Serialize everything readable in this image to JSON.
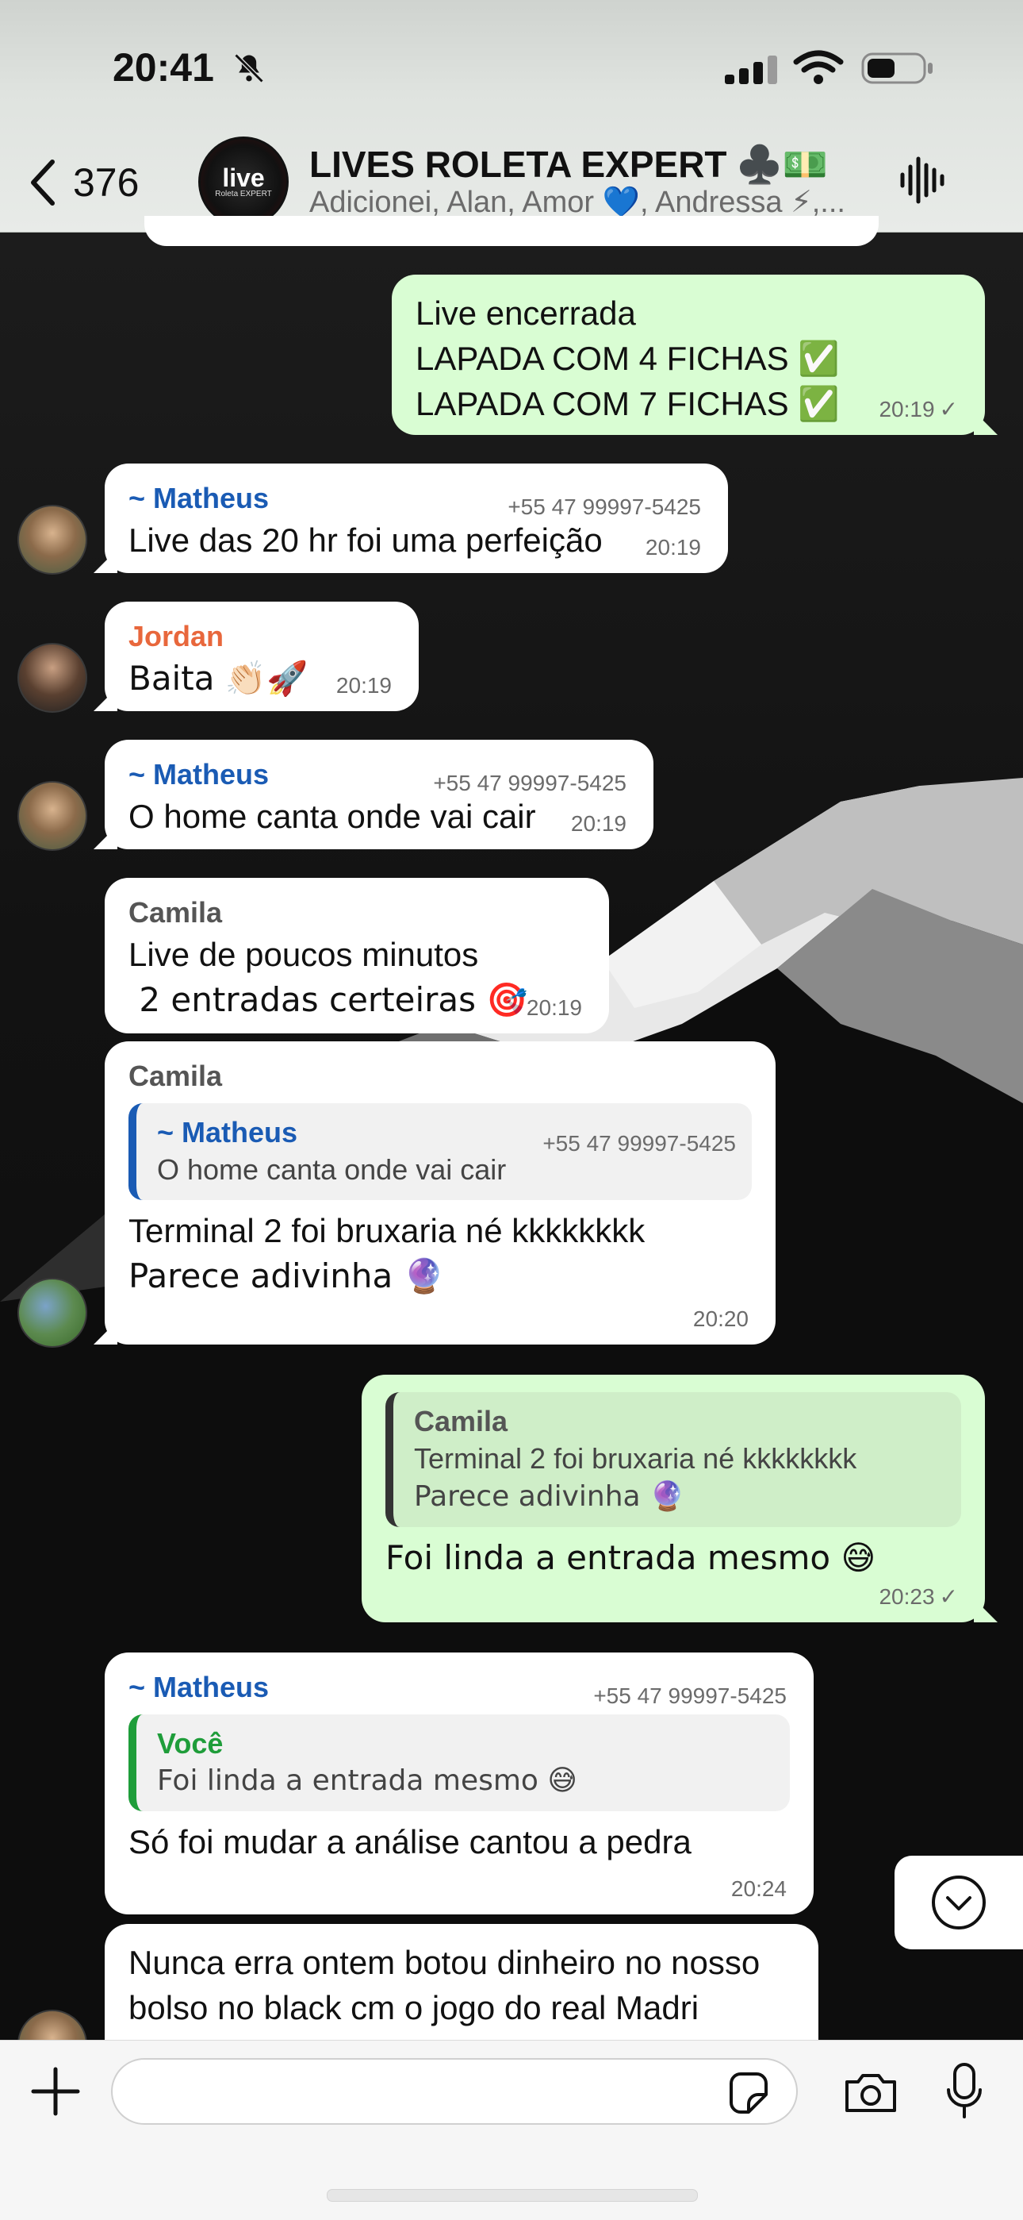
{
  "status_bar": {
    "time": "20:41"
  },
  "header": {
    "back_count": "376",
    "avatar_text_main": "live",
    "avatar_text_sub": "Roleta EXPERT",
    "title": "LIVES ROLETA EXPERT ♣️💵",
    "members": "Adicionei, Alan, Amor 💙, Andressa ⚡,..."
  },
  "messages": [
    {
      "direction": "out",
      "lines": [
        "Live encerrada",
        "LAPADA COM 4 FICHAS ✅",
        "LAPADA COM 7 FICHAS ✅"
      ],
      "time": "20:19"
    },
    {
      "direction": "in",
      "sender": "~ Matheus",
      "phone": "+55 47 99997-5425",
      "text": "Live das 20 hr foi uma perfeição",
      "time": "20:19"
    },
    {
      "direction": "in",
      "sender": "Jordan",
      "text": "Baita 👏🏻🚀",
      "time": "20:19"
    },
    {
      "direction": "in",
      "sender": "~ Matheus",
      "phone": "+55 47 99997-5425",
      "text": "O home canta onde vai cair",
      "time": "20:19"
    },
    {
      "direction": "in",
      "sender": "Camila",
      "lines": [
        "Live de poucos minutos",
        " 2 entradas certeiras 🎯"
      ],
      "time": "20:19"
    },
    {
      "direction": "in",
      "sender": "Camila",
      "quote": {
        "name": "~ Matheus",
        "phone": "+55 47 99997-5425",
        "text": "O home canta onde vai cair"
      },
      "lines": [
        "Terminal 2 foi bruxaria né kkkkkkkk",
        "Parece adivinha 🔮"
      ],
      "time": "20:20"
    },
    {
      "direction": "out",
      "quote": {
        "name": "Camila",
        "lines": [
          "Terminal 2 foi bruxaria né kkkkkkkk",
          "Parece adivinha 🔮"
        ]
      },
      "text": "Foi linda a entrada mesmo 😅",
      "time": "20:23"
    },
    {
      "direction": "in",
      "sender": "~ Matheus",
      "phone": "+55 47 99997-5425",
      "quote": {
        "name": "Você",
        "text": "Foi linda a entrada mesmo 😅"
      },
      "text": "Só foi mudar a análise cantou a pedra",
      "time": "20:24"
    },
    {
      "direction": "in",
      "lines": [
        "Nunca erra ontem botou dinheiro no nosso",
        "bolso no black cm o jogo do real Madri"
      ]
    }
  ],
  "colors": {
    "matheus": "#1a5bb4",
    "jordan": "#e8673c",
    "camila": "#555555",
    "voce": "#1f9d3a",
    "outgoing_bubble": "#d9fdd3",
    "incoming_bubble": "#ffffff"
  },
  "input": {
    "placeholder": ""
  },
  "icons": [
    "back-chevron-icon",
    "audio-wave-icon",
    "plus-icon",
    "sticker-icon",
    "camera-icon",
    "microphone-icon",
    "chevron-down-circle-icon"
  ]
}
